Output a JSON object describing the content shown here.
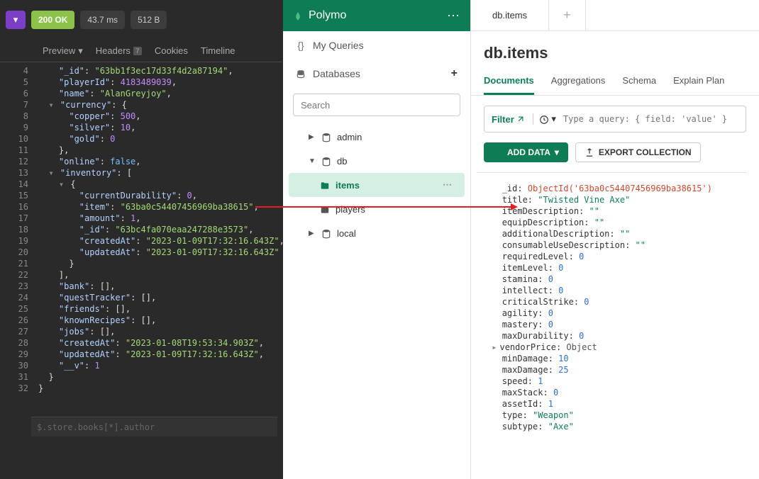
{
  "left": {
    "status": {
      "code": "200",
      "text": "OK"
    },
    "metrics": {
      "time": "43.7 ms",
      "size": "512 B"
    },
    "tabs": {
      "preview": "Preview",
      "headers": "Headers",
      "headers_badge": "7",
      "cookies": "Cookies",
      "timeline": "Timeline"
    },
    "lines": [
      {
        "n": 4,
        "indent": 2,
        "code": "\"_id\"",
        "rest": ": ",
        "val": "\"63bb1f3ec17d33f4d2a87194\"",
        "vtype": "s",
        "comma": true
      },
      {
        "n": 5,
        "indent": 2,
        "code": "\"playerId\"",
        "rest": ": ",
        "val": "4183489039",
        "vtype": "n",
        "comma": true
      },
      {
        "n": 6,
        "indent": 2,
        "code": "\"name\"",
        "rest": ": ",
        "val": "\"AlanGreyjoy\"",
        "vtype": "s",
        "comma": true
      },
      {
        "n": 7,
        "indent": 2,
        "fold": true,
        "code": "\"currency\"",
        "rest": ": {",
        "vtype": "p"
      },
      {
        "n": 8,
        "indent": 3,
        "code": "\"copper\"",
        "rest": ": ",
        "val": "500",
        "vtype": "n",
        "comma": true
      },
      {
        "n": 9,
        "indent": 3,
        "code": "\"silver\"",
        "rest": ": ",
        "val": "10",
        "vtype": "n",
        "comma": true
      },
      {
        "n": 10,
        "indent": 3,
        "code": "\"gold\"",
        "rest": ": ",
        "val": "0",
        "vtype": "n"
      },
      {
        "n": 11,
        "indent": 2,
        "code": "",
        "rest": "},",
        "plain": true
      },
      {
        "n": 12,
        "indent": 2,
        "code": "\"online\"",
        "rest": ": ",
        "val": "false",
        "vtype": "b",
        "comma": true
      },
      {
        "n": 13,
        "indent": 2,
        "fold": true,
        "code": "\"inventory\"",
        "rest": ": [",
        "vtype": "p"
      },
      {
        "n": 14,
        "indent": 3,
        "fold": true,
        "code": "",
        "rest": "{",
        "plain": true
      },
      {
        "n": 15,
        "indent": 4,
        "code": "\"currentDurability\"",
        "rest": ": ",
        "val": "0",
        "vtype": "n",
        "comma": true
      },
      {
        "n": 16,
        "indent": 4,
        "code": "\"item\"",
        "rest": ": ",
        "val": "\"63ba0c54407456969ba38615\"",
        "vtype": "s",
        "comma": true
      },
      {
        "n": 17,
        "indent": 4,
        "code": "\"amount\"",
        "rest": ": ",
        "val": "1",
        "vtype": "n",
        "comma": true
      },
      {
        "n": 18,
        "indent": 4,
        "code": "\"_id\"",
        "rest": ": ",
        "val": "\"63bc4fa070eaa247288e3573\"",
        "vtype": "s",
        "comma": true
      },
      {
        "n": 19,
        "indent": 4,
        "code": "\"createdAt\"",
        "rest": ": ",
        "val": "\"2023-01-09T17:32:16.643Z\"",
        "vtype": "s",
        "comma": true
      },
      {
        "n": 20,
        "indent": 4,
        "code": "\"updatedAt\"",
        "rest": ": ",
        "val": "\"2023-01-09T17:32:16.643Z\"",
        "vtype": "s"
      },
      {
        "n": 21,
        "indent": 3,
        "code": "",
        "rest": "}",
        "plain": true
      },
      {
        "n": 22,
        "indent": 2,
        "code": "",
        "rest": "],",
        "plain": true
      },
      {
        "n": 23,
        "indent": 2,
        "code": "\"bank\"",
        "rest": ": [],",
        "vtype": "p",
        "inline": true
      },
      {
        "n": 24,
        "indent": 2,
        "code": "\"questTracker\"",
        "rest": ": [],",
        "vtype": "p",
        "inline": true
      },
      {
        "n": 25,
        "indent": 2,
        "code": "\"friends\"",
        "rest": ": [],",
        "vtype": "p",
        "inline": true
      },
      {
        "n": 26,
        "indent": 2,
        "code": "\"knownRecipes\"",
        "rest": ": [],",
        "vtype": "p",
        "inline": true
      },
      {
        "n": 27,
        "indent": 2,
        "code": "\"jobs\"",
        "rest": ": [],",
        "vtype": "p",
        "inline": true
      },
      {
        "n": 28,
        "indent": 2,
        "code": "\"createdAt\"",
        "rest": ": ",
        "val": "\"2023-01-08T19:53:34.903Z\"",
        "vtype": "s",
        "comma": true
      },
      {
        "n": 29,
        "indent": 2,
        "code": "\"updatedAt\"",
        "rest": ": ",
        "val": "\"2023-01-09T17:32:16.643Z\"",
        "vtype": "s",
        "comma": true
      },
      {
        "n": 30,
        "indent": 2,
        "code": "\"__v\"",
        "rest": ": ",
        "val": "1",
        "vtype": "n"
      },
      {
        "n": 31,
        "indent": 1,
        "code": "",
        "rest": "}",
        "plain": true
      },
      {
        "n": 32,
        "indent": 0,
        "code": "",
        "rest": "}",
        "plain": true
      }
    ],
    "footer_placeholder": "$.store.books[*].author"
  },
  "sidebar": {
    "brand": "Polymo",
    "section_queries": "My Queries",
    "section_databases": "Databases",
    "search_placeholder": "Search",
    "tree": {
      "admin": "admin",
      "db": "db",
      "items": "items",
      "players": "players",
      "local": "local"
    }
  },
  "right": {
    "top_tab": "db.items",
    "title_db": "db.",
    "title_coll": "items",
    "subtabs": [
      "Documents",
      "Aggregations",
      "Schema",
      "Explain Plan"
    ],
    "filter_label": "Filter",
    "query_placeholder": "Type a query: { field: 'value' }",
    "add_data": "ADD DATA",
    "export": "EXPORT COLLECTION",
    "doc": [
      {
        "k": "_id",
        "v": "ObjectId('63ba0c54407456969ba38615')",
        "t": "id"
      },
      {
        "k": "title",
        "v": "\"Twisted Vine Axe\"",
        "t": "s"
      },
      {
        "k": "itemDescription",
        "v": "\"\"",
        "t": "s"
      },
      {
        "k": "equipDescription",
        "v": "\"\"",
        "t": "s"
      },
      {
        "k": "additionalDescription",
        "v": "\"\"",
        "t": "s"
      },
      {
        "k": "consumableUseDescription",
        "v": "\"\"",
        "t": "s"
      },
      {
        "k": "requiredLevel",
        "v": "0",
        "t": "n"
      },
      {
        "k": "itemLevel",
        "v": "0",
        "t": "n"
      },
      {
        "k": "stamina",
        "v": "0",
        "t": "n"
      },
      {
        "k": "intellect",
        "v": "0",
        "t": "n"
      },
      {
        "k": "criticalStrike",
        "v": "0",
        "t": "n"
      },
      {
        "k": "agility",
        "v": "0",
        "t": "n"
      },
      {
        "k": "mastery",
        "v": "0",
        "t": "n"
      },
      {
        "k": "maxDurability",
        "v": "0",
        "t": "n"
      },
      {
        "k": "vendorPrice",
        "v": "Object",
        "t": "o",
        "expand": true
      },
      {
        "k": "minDamage",
        "v": "10",
        "t": "n"
      },
      {
        "k": "maxDamage",
        "v": "25",
        "t": "n"
      },
      {
        "k": "speed",
        "v": "1",
        "t": "n"
      },
      {
        "k": "maxStack",
        "v": "0",
        "t": "n"
      },
      {
        "k": "assetId",
        "v": "1",
        "t": "n"
      },
      {
        "k": "type",
        "v": "\"Weapon\"",
        "t": "s"
      },
      {
        "k": "subtype",
        "v": "\"Axe\"",
        "t": "s"
      }
    ]
  }
}
